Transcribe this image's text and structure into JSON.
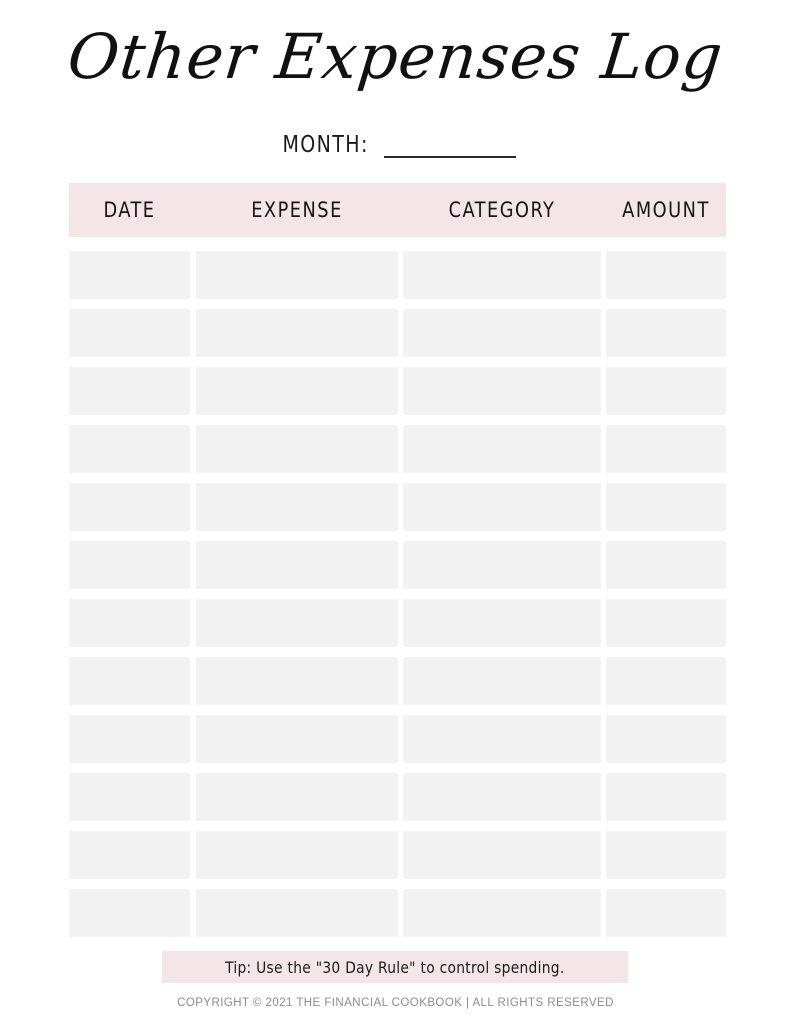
{
  "document": {
    "title": "Other Expenses Log",
    "page_background": "#ffffff",
    "accent_pink": "#f4e6e7",
    "cell_gray": "#f2f2f2",
    "text_color": "#151515"
  },
  "month_field": {
    "label": "MONTH:",
    "value": "",
    "placeholder": ""
  },
  "table": {
    "columns": [
      {
        "key": "date",
        "label": "DATE"
      },
      {
        "key": "expense",
        "label": "EXPENSE"
      },
      {
        "key": "category",
        "label": "CATEGORY"
      },
      {
        "key": "amount",
        "label": "AMOUNT"
      }
    ],
    "row_count": 12,
    "rows": [
      {
        "date": "",
        "expense": "",
        "category": "",
        "amount": ""
      },
      {
        "date": "",
        "expense": "",
        "category": "",
        "amount": ""
      },
      {
        "date": "",
        "expense": "",
        "category": "",
        "amount": ""
      },
      {
        "date": "",
        "expense": "",
        "category": "",
        "amount": ""
      },
      {
        "date": "",
        "expense": "",
        "category": "",
        "amount": ""
      },
      {
        "date": "",
        "expense": "",
        "category": "",
        "amount": ""
      },
      {
        "date": "",
        "expense": "",
        "category": "",
        "amount": ""
      },
      {
        "date": "",
        "expense": "",
        "category": "",
        "amount": ""
      },
      {
        "date": "",
        "expense": "",
        "category": "",
        "amount": ""
      },
      {
        "date": "",
        "expense": "",
        "category": "",
        "amount": ""
      },
      {
        "date": "",
        "expense": "",
        "category": "",
        "amount": ""
      },
      {
        "date": "",
        "expense": "",
        "category": "",
        "amount": ""
      }
    ]
  },
  "tip": {
    "text": "Tip: Use the \"30 Day Rule\" to control spending."
  },
  "footer": {
    "copyright": "COPYRIGHT © 2021 THE FINANCIAL COOKBOOK | ALL RIGHTS RESERVED"
  }
}
